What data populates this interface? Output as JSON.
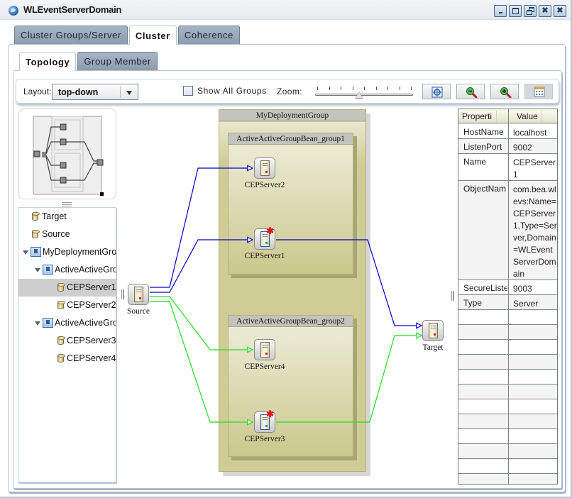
{
  "window": {
    "title": "WLEventServerDomain",
    "controls": [
      "minimize",
      "maximize",
      "restore",
      "close-all",
      "close"
    ]
  },
  "outer_tabs": [
    {
      "label": "Cluster Groups/Server",
      "active": false
    },
    {
      "label": "Cluster",
      "active": true
    },
    {
      "label": "Coherence",
      "active": false
    }
  ],
  "inner_tabs": [
    {
      "label": "Topology",
      "active": true
    },
    {
      "label": "Group Member",
      "active": false
    }
  ],
  "toolbar": {
    "layout_label": "Layout:",
    "layout_value": "top-down",
    "show_all_groups_label": "Show All Groups",
    "show_all_groups_checked": false,
    "zoom_label": "Zoom:",
    "zoom_level_fraction": 0.45,
    "buttons": [
      "fit-to-window",
      "zoom-out",
      "zoom-in",
      "grid-view"
    ]
  },
  "tree": {
    "items": [
      {
        "label": "Target",
        "type": "server",
        "level": 1
      },
      {
        "label": "Source",
        "type": "server",
        "level": 1
      },
      {
        "label": "MyDeploymentGro",
        "type": "group",
        "level": 0,
        "expanded": true
      },
      {
        "label": "ActiveActiveGrou",
        "type": "group",
        "level": 1,
        "expanded": true
      },
      {
        "label": "CEPServer1",
        "type": "server",
        "level": 2,
        "selected": true
      },
      {
        "label": "CEPServer2",
        "type": "server",
        "level": 2
      },
      {
        "label": "ActiveActiveGrou",
        "type": "group",
        "level": 1,
        "expanded": true
      },
      {
        "label": "CEPServer3",
        "type": "server",
        "level": 2
      },
      {
        "label": "CEPServer4",
        "type": "server",
        "level": 2
      }
    ]
  },
  "diagram": {
    "deployment_group": "MyDeploymentGroup",
    "groups": [
      {
        "name": "ActiveActiveGroupBean_group1"
      },
      {
        "name": "ActiveActiveGroupBean_group2"
      }
    ],
    "nodes": {
      "source": {
        "label": "Source"
      },
      "target": {
        "label": "Target"
      },
      "cep2": {
        "label": "CEPServer2",
        "active": false
      },
      "cep1": {
        "label": "CEPServer1",
        "active": true
      },
      "cep4": {
        "label": "CEPServer4",
        "active": false
      },
      "cep3": {
        "label": "CEPServer3",
        "active": true
      }
    },
    "edge_colors": {
      "group1": "#0000cc",
      "group2": "#22dd22"
    }
  },
  "properties": {
    "headers": [
      "Properti",
      "Value"
    ],
    "rows": [
      {
        "key": "HostName",
        "value": "localhost"
      },
      {
        "key": "ListenPort",
        "value": "9002"
      },
      {
        "key": "Name",
        "value": "CEPServer1"
      },
      {
        "key": "ObjectNam",
        "value": "com.bea.wlevs:Name=CEPServer1,Type=Server,Domain=WLEventServerDomain"
      },
      {
        "key": "SecureListe",
        "value": "9003"
      },
      {
        "key": "Type",
        "value": "Server"
      }
    ]
  }
}
